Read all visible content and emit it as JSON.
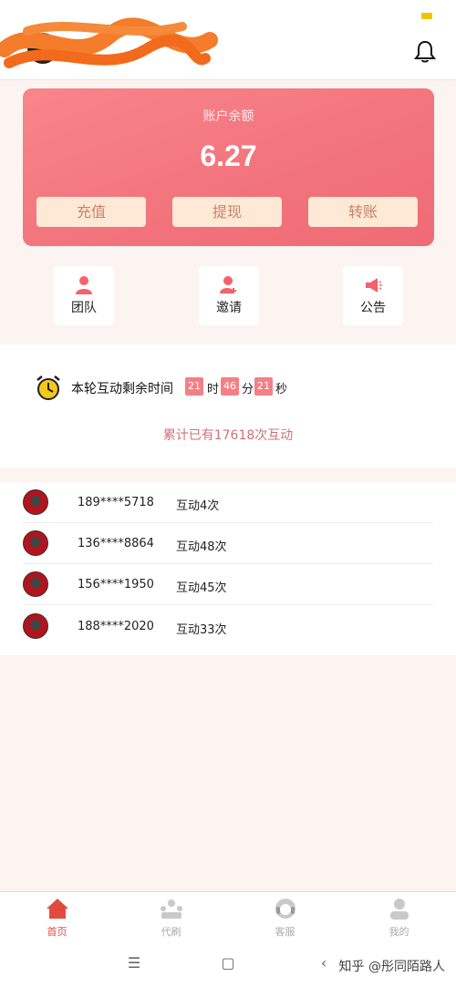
{
  "header": {
    "bell_icon": "bell-icon"
  },
  "balance": {
    "label": "账户余额",
    "value": "6.27",
    "buttons": [
      "充值",
      "提现",
      "转账"
    ]
  },
  "quick_actions": [
    {
      "label": "团队",
      "icon": "team-icon"
    },
    {
      "label": "邀请",
      "icon": "invite-icon"
    },
    {
      "label": "公告",
      "icon": "megaphone-icon"
    }
  ],
  "timer": {
    "label": "本轮互动剩余时间",
    "hours": "21",
    "hours_unit": "时",
    "minutes": "46",
    "minutes_unit": "分",
    "seconds": "21",
    "seconds_unit": "秒",
    "total_text": "累计已有17618次互动"
  },
  "records": [
    {
      "phone": "189****5718",
      "count": "互动4次"
    },
    {
      "phone": "136****8864",
      "count": "互动48次"
    },
    {
      "phone": "156****1950",
      "count": "互动45次"
    },
    {
      "phone": "188****2020",
      "count": "互动33次"
    }
  ],
  "tabs": [
    {
      "label": "首页",
      "icon": "home-icon",
      "active": true
    },
    {
      "label": "代刷",
      "icon": "task-icon",
      "active": false
    },
    {
      "label": "客服",
      "icon": "headset-icon",
      "active": false
    },
    {
      "label": "我的",
      "icon": "user-icon",
      "active": false
    }
  ],
  "system_nav": {
    "menu": "☰",
    "home": "▢",
    "back": "‹"
  },
  "watermark": "知乎 @彤同陌路人",
  "colors": {
    "accent": "#f2737c",
    "button_bg": "#fde9d5",
    "button_text": "#c8826d",
    "tab_active": "#e24a3f",
    "timer_box": "#f67f86"
  }
}
